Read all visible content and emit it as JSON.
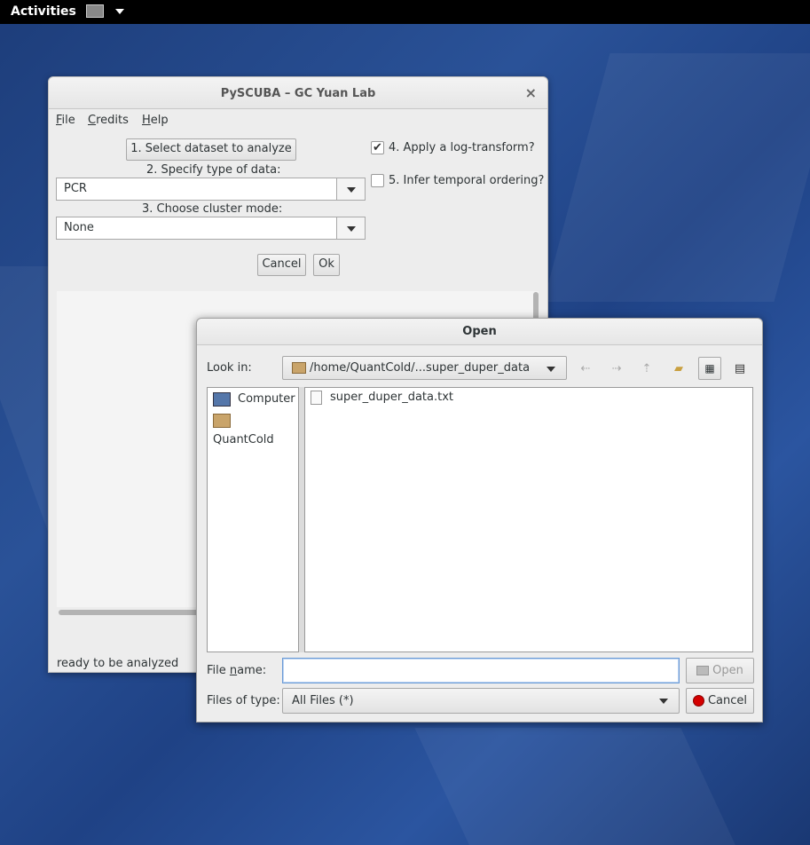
{
  "topbar": {
    "activities": "Activities"
  },
  "main_window": {
    "title": "PySCUBA – GC Yuan Lab",
    "close_glyph": "×",
    "menu": [
      {
        "pre": "",
        "ul": "F",
        "post": "ile"
      },
      {
        "pre": "",
        "ul": "C",
        "post": "redits"
      },
      {
        "pre": "",
        "ul": "H",
        "post": "elp"
      }
    ],
    "select_dataset_button": "1. Select dataset to analyze",
    "data_type_label": "2. Specify type of data:",
    "data_type_value": "PCR",
    "cluster_mode_label": "3. Choose cluster mode:",
    "cluster_mode_value": "None",
    "log_transform_label": "4. Apply a log-transform?",
    "log_transform_checked": true,
    "temporal_label": "5. Infer temporal ordering?",
    "temporal_checked": false,
    "cancel_button": "Cancel",
    "ok_button": "Ok",
    "status": "ready to be analyzed"
  },
  "open_dialog": {
    "title": "Open",
    "look_in_label": "Look in:",
    "look_in_value": "/home/QuantCold/...super_duper_data",
    "sidebar": [
      {
        "label": "Computer",
        "icon": "computer-icon"
      },
      {
        "label": "QuantCold",
        "icon": "home-folder-icon"
      }
    ],
    "files": [
      {
        "name": "super_duper_data.txt",
        "icon": "text-file-icon"
      }
    ],
    "file_name_label_pre": "File ",
    "file_name_label_ul": "n",
    "file_name_label_post": "ame:",
    "file_name_value": "",
    "open_button": "Open",
    "files_of_type_label": "Files of type:",
    "files_of_type_value": "All Files (*)",
    "cancel_button": "Cancel"
  }
}
